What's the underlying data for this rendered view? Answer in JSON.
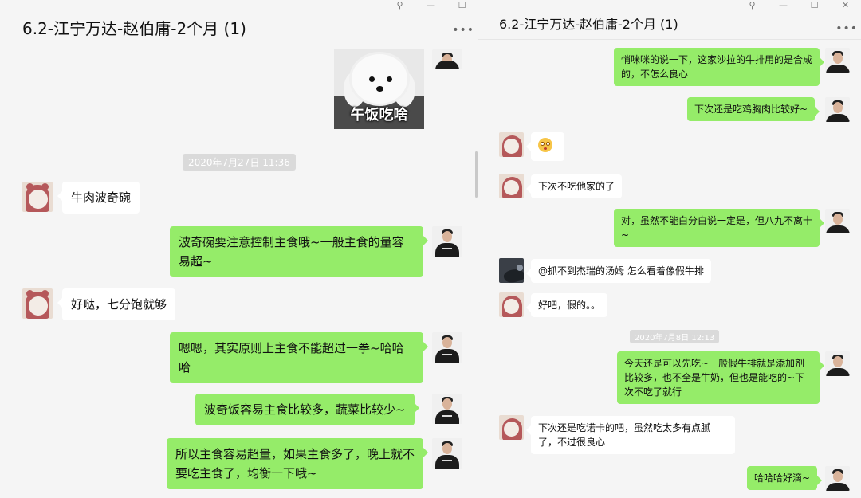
{
  "left_window": {
    "title": "6.2-江宁万达-赵伯庸-2个月 (1)",
    "controls": {
      "pin": "⚲",
      "minimize": "—",
      "maximize": "☐",
      "close": "✕"
    },
    "more": "•••",
    "sticker_caption": "午饭吃啥",
    "timestamp": "2020年7月27日 11:36",
    "messages": [
      {
        "from": "them",
        "text": "牛肉波奇碗"
      },
      {
        "from": "me",
        "text": "波奇碗要注意控制主食哦~一般主食的量容易超~"
      },
      {
        "from": "them",
        "text": "好哒，七分饱就够"
      },
      {
        "from": "me",
        "text": "嗯嗯，其实原则上主食不能超过一拳~哈哈哈"
      },
      {
        "from": "me",
        "text": "波奇饭容易主食比较多，蔬菜比较少~"
      },
      {
        "from": "me",
        "text": "所以主食容易超量，如果主食多了，晚上就不要吃主食了，均衡一下哦~"
      }
    ]
  },
  "right_window": {
    "title": "6.2-江宁万达-赵伯庸-2个月 (1)",
    "controls": {
      "pin": "⚲",
      "minimize": "—",
      "maximize": "☐",
      "close": "✕"
    },
    "more": "•••",
    "timestamp": "2020年7月8日 12:13",
    "messages": [
      {
        "from": "me",
        "text": "悄咪咪的说一下，这家沙拉的牛排用的是合成的，不怎么良心"
      },
      {
        "from": "me",
        "text": "下次还是吃鸡胸肉比较好~"
      },
      {
        "from": "them",
        "text": "",
        "emoji": "flushed-face"
      },
      {
        "from": "them",
        "text": "下次不吃他家的了"
      },
      {
        "from": "me",
        "text": "对，虽然不能白分白说一定是，但八九不离十~"
      },
      {
        "from": "other",
        "text": "@抓不到杰瑞的汤姆 怎么看着像假牛排"
      },
      {
        "from": "them",
        "text": "好吧，假的。。"
      },
      {
        "from": "me",
        "text": "今天还是可以先吃~一般假牛排就是添加剂比较多，也不全是牛奶，但也是能吃的~下次不吃了就行"
      },
      {
        "from": "them",
        "text": "下次还是吃诺卡的吧，虽然吃太多有点腻了，不过很良心"
      },
      {
        "from": "me",
        "text": "哈哈哈好滴~"
      }
    ]
  },
  "colors": {
    "me_bubble": "#95ec69",
    "them_bubble": "#ffffff",
    "chat_bg": "#f5f5f5"
  }
}
